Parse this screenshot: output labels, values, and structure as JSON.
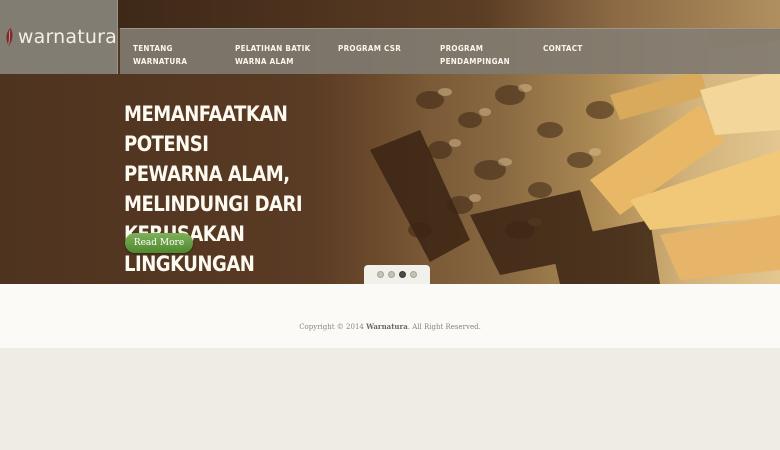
{
  "brand": {
    "name": "warnatura"
  },
  "nav": {
    "items": [
      {
        "label": "TENTANG\nWARNATURA"
      },
      {
        "label": "PELATIHAN BATIK\nWARNA ALAM"
      },
      {
        "label": "PROGRAM CSR"
      },
      {
        "label": "PROGRAM\nPENDAMPINGAN"
      },
      {
        "label": "CONTACT"
      }
    ]
  },
  "hero": {
    "headline": "MEMANFAATKAN POTENSI\nPEWARNA ALAM,\nMELINDUNGI DARI\nKERUSAKAN LINGKUNGAN",
    "read_more": "Read More"
  },
  "slider": {
    "total": 4,
    "active_index": 2
  },
  "footer": {
    "copyright_prefix": "Copyright © 2014",
    "copyright_brand": "Warnatura",
    "copyright_suffix": ". All Right Reserved."
  },
  "colors": {
    "nav_bg": "#807a70",
    "hero_dark": "#4e331f",
    "button_green": "#5e9a3b",
    "page_bg": "#efece6"
  }
}
